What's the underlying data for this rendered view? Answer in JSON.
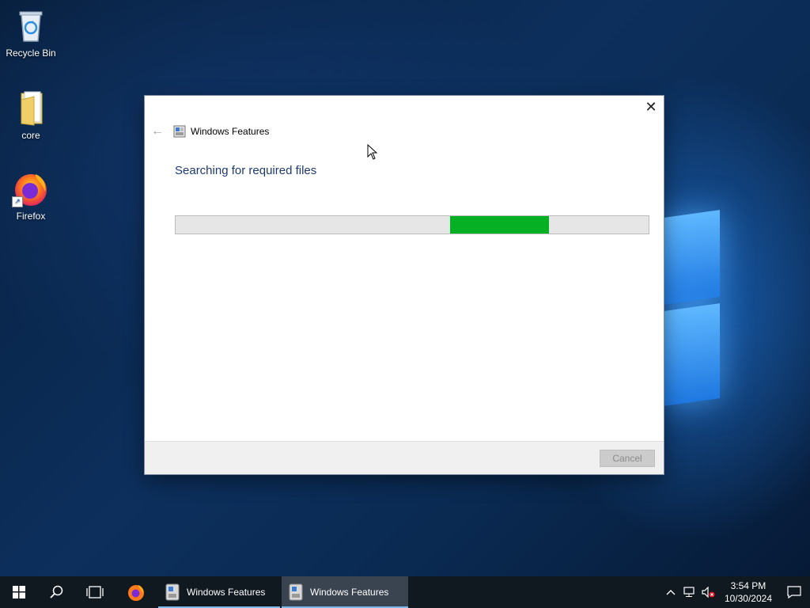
{
  "desktop": {
    "icons": [
      {
        "label": "Recycle Bin",
        "icon": "recycle-bin-icon"
      },
      {
        "label": "core",
        "icon": "folder-icon"
      },
      {
        "label": "Firefox",
        "icon": "firefox-icon"
      }
    ]
  },
  "dialog": {
    "title": "Windows Features",
    "heading": "Searching for required files",
    "close_icon": "close-icon",
    "back_icon": "back-arrow-icon",
    "progress": {
      "kind": "marquee",
      "fill_start": 0.58,
      "fill_end": 0.79,
      "color": "#06b025"
    },
    "cancel_label": "Cancel"
  },
  "taskbar": {
    "start_icon": "windows-start-icon",
    "search_icon": "search-icon",
    "task_view_icon": "task-view-icon",
    "apps": [
      {
        "label": "Windows Features",
        "icon": "windows-features-icon",
        "active": false
      },
      {
        "label": "Windows Features",
        "icon": "windows-features-icon",
        "active": true
      }
    ],
    "pinned_icon": "firefox-icon",
    "tray": {
      "chevron_icon": "chevron-up-icon",
      "network_icon": "network-icon",
      "volume_icon": "volume-muted-icon",
      "time": "3:54 PM",
      "date": "10/30/2024",
      "notification_icon": "notification-icon"
    }
  },
  "colors": {
    "accent": "#06b025",
    "heading": "#1e3a6f",
    "taskbar": "#101820"
  }
}
